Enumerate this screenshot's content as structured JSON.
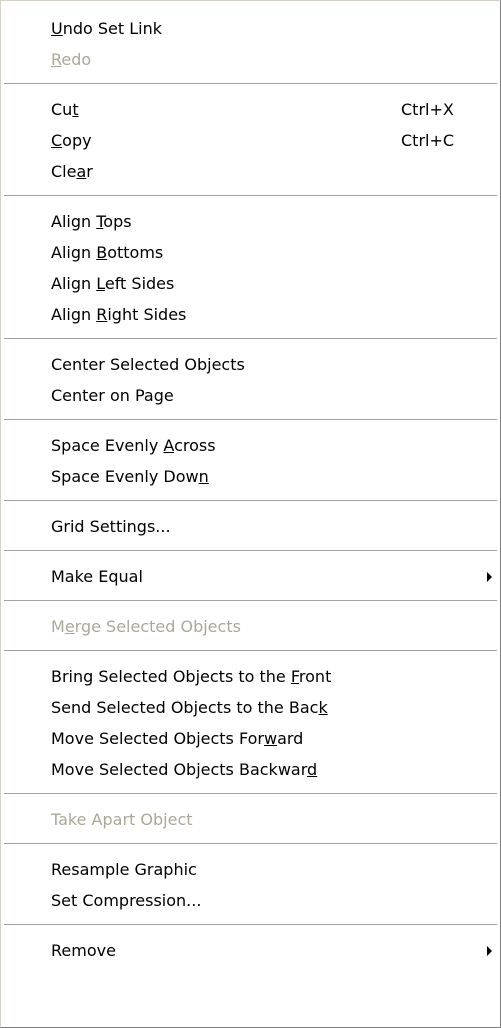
{
  "menu": {
    "groups": [
      [
        {
          "name": "undo",
          "pre": "",
          "key": "U",
          "post": "ndo Set Link",
          "disabled": false
        },
        {
          "name": "redo",
          "pre": "",
          "key": "R",
          "post": "edo",
          "disabled": true
        }
      ],
      [
        {
          "name": "cut",
          "pre": "Cu",
          "key": "t",
          "post": "",
          "shortcut": "Ctrl+X",
          "disabled": false
        },
        {
          "name": "copy",
          "pre": "",
          "key": "C",
          "post": "opy",
          "shortcut": "Ctrl+C",
          "disabled": false
        },
        {
          "name": "clear",
          "pre": "Cle",
          "key": "a",
          "post": "r",
          "disabled": false
        }
      ],
      [
        {
          "name": "align-tops",
          "pre": "Align ",
          "key": "T",
          "post": "ops",
          "disabled": false
        },
        {
          "name": "align-bottoms",
          "pre": "Align ",
          "key": "B",
          "post": "ottoms",
          "disabled": false
        },
        {
          "name": "align-left-sides",
          "pre": "Align ",
          "key": "L",
          "post": "eft Sides",
          "disabled": false
        },
        {
          "name": "align-right-sides",
          "pre": "Align ",
          "key": "R",
          "post": "ight Sides",
          "disabled": false
        }
      ],
      [
        {
          "name": "center-selected-objects",
          "pre": "Center Selected Objects",
          "key": "",
          "post": "",
          "disabled": false
        },
        {
          "name": "center-on-page",
          "pre": "Center on Page",
          "key": "",
          "post": "",
          "disabled": false
        }
      ],
      [
        {
          "name": "space-evenly-across",
          "pre": "Space Evenly ",
          "key": "A",
          "post": "cross",
          "disabled": false
        },
        {
          "name": "space-evenly-down",
          "pre": "Space Evenly Dow",
          "key": "n",
          "post": "",
          "disabled": false
        }
      ],
      [
        {
          "name": "grid-settings",
          "pre": "Grid Settings...",
          "key": "",
          "post": "",
          "disabled": false
        }
      ],
      [
        {
          "name": "make-equal",
          "pre": "Make Equal",
          "key": "",
          "post": "",
          "submenu": true,
          "disabled": false
        }
      ],
      [
        {
          "name": "merge-selected-objects",
          "pre": "M",
          "key": "e",
          "post": "rge Selected Objects",
          "disabled": true
        }
      ],
      [
        {
          "name": "bring-to-front",
          "pre": "Bring Selected Objects to the ",
          "key": "F",
          "post": "ront",
          "disabled": false
        },
        {
          "name": "send-to-back",
          "pre": "Send Selected Objects to the Bac",
          "key": "k",
          "post": "",
          "disabled": false
        },
        {
          "name": "move-forward",
          "pre": "Move Selected Objects For",
          "key": "w",
          "post": "ard",
          "disabled": false
        },
        {
          "name": "move-backward",
          "pre": "Move Selected Objects Backwar",
          "key": "d",
          "post": "",
          "disabled": false
        }
      ],
      [
        {
          "name": "take-apart-object",
          "pre": "Take Apart Object",
          "key": "",
          "post": "",
          "disabled": true
        }
      ],
      [
        {
          "name": "resample-graphic",
          "pre": "Resample Graphic",
          "key": "",
          "post": "",
          "disabled": false
        },
        {
          "name": "set-compression",
          "pre": "Set Compression...",
          "key": "",
          "post": "",
          "disabled": false
        }
      ],
      [
        {
          "name": "remove",
          "pre": "Remove",
          "key": "",
          "post": "",
          "submenu": true,
          "disabled": false
        }
      ]
    ]
  }
}
